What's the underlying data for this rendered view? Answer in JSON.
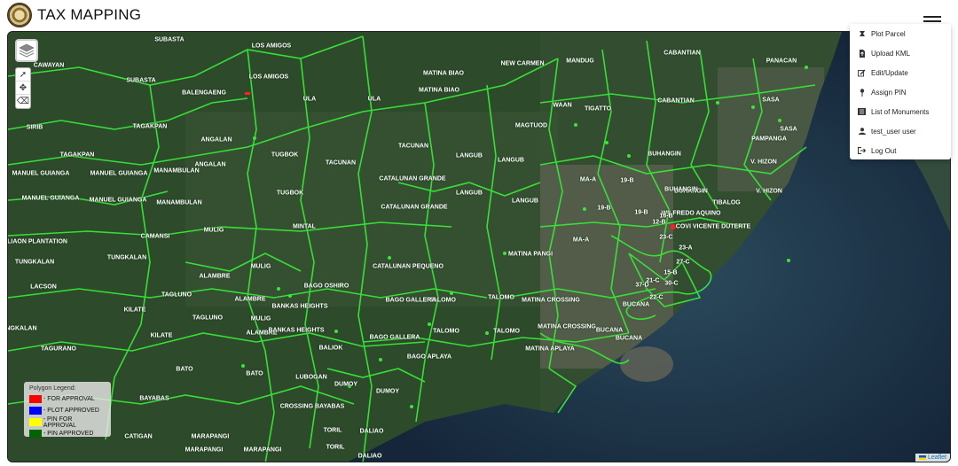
{
  "app": {
    "title": "TAX MAPPING"
  },
  "menu": {
    "items": [
      {
        "label": "Plot Parcel",
        "icon": "map-plot-icon"
      },
      {
        "label": "Upload KML",
        "icon": "upload-file-icon"
      },
      {
        "label": "Edit/Update",
        "icon": "edit-icon"
      },
      {
        "label": "Assign PIN",
        "icon": "pin-icon"
      },
      {
        "label": "List of Monuments",
        "icon": "list-icon"
      },
      {
        "label": "test_user user",
        "icon": "user-icon"
      },
      {
        "label": "Log Out",
        "icon": "logout-icon"
      }
    ]
  },
  "legend": {
    "title": "Polygon Legend:",
    "items": [
      {
        "label": "- FOR APPROVAL",
        "color": "#ff0000"
      },
      {
        "label": "- PLOT APPROVED",
        "color": "#0000ff"
      },
      {
        "label": "- PIN FOR APPROVAL",
        "color": "#ffff00"
      },
      {
        "label": "- PIN APPROVED",
        "color": "#006400"
      }
    ]
  },
  "attribution": {
    "text": "Leaflet"
  },
  "colors": {
    "boundary": "#39e639",
    "water": "#1b2f44",
    "land": "#2f4a2c"
  },
  "places": [
    {
      "name": "CAWAYAN"
    },
    {
      "name": "SUBASTA"
    },
    {
      "name": "SUBASTA"
    },
    {
      "name": "LOS AMIGOS"
    },
    {
      "name": "LOS AMIGOS"
    },
    {
      "name": "BALENGAENG"
    },
    {
      "name": "ULA"
    },
    {
      "name": "ULA"
    },
    {
      "name": "MATINA BIAO"
    },
    {
      "name": "MATINA BIAO"
    },
    {
      "name": "NEW CARMEN"
    },
    {
      "name": "MANDUG"
    },
    {
      "name": "CABANTIAN"
    },
    {
      "name": "PANACAN"
    },
    {
      "name": "SIRIB"
    },
    {
      "name": "TAGAKPAN"
    },
    {
      "name": "TAGAKPAN"
    },
    {
      "name": "ANGALAN"
    },
    {
      "name": "ANGALAN"
    },
    {
      "name": "TACUNAN"
    },
    {
      "name": "TACUNAN"
    },
    {
      "name": "MAGTUOD"
    },
    {
      "name": "WAAN"
    },
    {
      "name": "TIGATTO"
    },
    {
      "name": "CABANTIAN"
    },
    {
      "name": "SASA"
    },
    {
      "name": "SASA"
    },
    {
      "name": "MANUEL GUIANGA"
    },
    {
      "name": "MANUEL GUIANGA"
    },
    {
      "name": "MANUEL GUIANGA"
    },
    {
      "name": "MANUEL GUIANGA"
    },
    {
      "name": "MANAMBULAN"
    },
    {
      "name": "TUGBOK"
    },
    {
      "name": "TUGBOK"
    },
    {
      "name": "LANGUB"
    },
    {
      "name": "LANGUB"
    },
    {
      "name": "LANGUB"
    },
    {
      "name": "CATALUNAN GRANDE"
    },
    {
      "name": "CATALUNAN GRANDE"
    },
    {
      "name": "BUHANGIN"
    },
    {
      "name": "BUHANGIN"
    },
    {
      "name": "PAMPANGA"
    },
    {
      "name": "V. HIZON"
    },
    {
      "name": "V. HIZON"
    },
    {
      "name": "MA-A"
    },
    {
      "name": "MA-A"
    },
    {
      "name": "MANAMBULAN"
    },
    {
      "name": "LANGUB"
    },
    {
      "name": "MINTAL"
    },
    {
      "name": "MULIG"
    },
    {
      "name": "DALIAON PLANTATION"
    },
    {
      "name": "CAMANSI"
    },
    {
      "name": "TUNGKALAN"
    },
    {
      "name": "TUNGKALAN"
    },
    {
      "name": "LACSON"
    },
    {
      "name": "MULIG"
    },
    {
      "name": "MULIG"
    },
    {
      "name": "BAGO OSHIRO"
    },
    {
      "name": "CATALUNAN PEQUENO"
    },
    {
      "name": "MATINA PANGI"
    },
    {
      "name": "MATINA CROSSING"
    },
    {
      "name": "TALOMO"
    },
    {
      "name": "TALOMO"
    },
    {
      "name": "BAGO GALLERA"
    },
    {
      "name": "TAGLUNO"
    },
    {
      "name": "TAGLUNO"
    },
    {
      "name": "ALAMBRE"
    },
    {
      "name": "ALAMBRE"
    },
    {
      "name": "ALAMBRE"
    },
    {
      "name": "BANKAS HEIGHTS"
    },
    {
      "name": "BANKAS HEIGHTS"
    },
    {
      "name": "KILATE"
    },
    {
      "name": "KILATE"
    },
    {
      "name": "BAGO GALLERA"
    },
    {
      "name": "TALOMO"
    },
    {
      "name": "TALOMO"
    },
    {
      "name": "MATINA CROSSING"
    },
    {
      "name": "BUCANA"
    },
    {
      "name": "BUCANA"
    },
    {
      "name": "BUCANA"
    },
    {
      "name": "NGKALAN"
    },
    {
      "name": "TAGURANO"
    },
    {
      "name": "BALIOK"
    },
    {
      "name": "BAGO APLAYA"
    },
    {
      "name": "MATINA APLAYA"
    },
    {
      "name": "BATO"
    },
    {
      "name": "BATO"
    },
    {
      "name": "LUBOGAN"
    },
    {
      "name": "DUMOY"
    },
    {
      "name": "DUMOY"
    },
    {
      "name": "BAYABAS"
    },
    {
      "name": "CROSSING BAYABAS"
    },
    {
      "name": "CATIGAN"
    },
    {
      "name": "MARAPANGI"
    },
    {
      "name": "MARAPANGI"
    },
    {
      "name": "MARAPANGI"
    },
    {
      "name": "TORIL"
    },
    {
      "name": "DALIAO"
    },
    {
      "name": "TORIL"
    },
    {
      "name": "DALIAO"
    },
    {
      "name": "19-B"
    },
    {
      "name": "19-B"
    },
    {
      "name": "19-B"
    },
    {
      "name": "COVI VICENTE DUTERTE"
    },
    {
      "name": "WILFREDO AQUINO"
    },
    {
      "name": "BUHANGIN"
    },
    {
      "name": "TIBALOG"
    },
    {
      "name": "16-B"
    },
    {
      "name": "23-C"
    },
    {
      "name": "27-C"
    },
    {
      "name": "37-D"
    },
    {
      "name": "30-C"
    },
    {
      "name": "21-C"
    },
    {
      "name": "22-C"
    },
    {
      "name": "12-B"
    },
    {
      "name": "15-B"
    },
    {
      "name": "23-A"
    }
  ]
}
